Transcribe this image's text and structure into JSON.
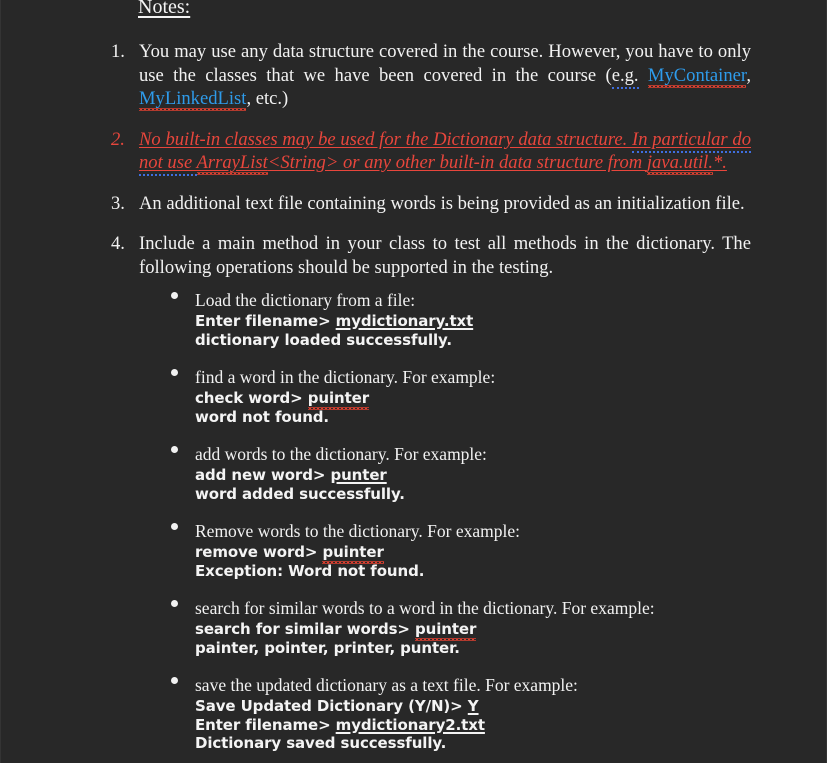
{
  "document": {
    "heading": "Notes:",
    "numbered_items": [
      {
        "marker": "1.",
        "lines": [
          {
            "segments": [
              {
                "text": "You may use any data structure covered in the course. However, you have to only use the classes that we have been covered in the course (",
                "style": "plain"
              },
              {
                "text": "e.g.",
                "style": "grammar"
              },
              {
                "text": " ",
                "style": "plain"
              },
              {
                "text": "MyContainer",
                "style": "code-spell"
              },
              {
                "text": ", ",
                "style": "plain"
              },
              {
                "text": "MyLinkedList",
                "style": "code-spell"
              },
              {
                "text": ", etc.)",
                "style": "plain"
              }
            ]
          }
        ]
      },
      {
        "marker": "2.",
        "emphasis": "red-italic-underline",
        "lines": [
          {
            "segments": [
              {
                "text": "No built-in classes may be used for the Dictionary data structure. ",
                "style": "underline"
              },
              {
                "text": "In particular do not use ",
                "style": "underline-grammar"
              },
              {
                "text": "ArrayList",
                "style": "underline-spell"
              },
              {
                "text": "<String> or any other built-in data structure from ",
                "style": "underline"
              },
              {
                "text": "java.util.",
                "style": "underline-spell"
              },
              {
                "text": "*.",
                "style": "underline"
              }
            ]
          }
        ]
      },
      {
        "marker": "3.",
        "lines": [
          {
            "segments": [
              {
                "text": "An additional text file containing words is being provided as an initialization file.",
                "style": "plain"
              }
            ]
          }
        ]
      },
      {
        "marker": "4.",
        "lines": [
          {
            "segments": [
              {
                "text": "Include a main method in your class to test all methods in the dictionary. The following operations should be supported in the testing.",
                "style": "plain"
              }
            ]
          }
        ]
      }
    ],
    "bullets": [
      {
        "description": "Load the dictionary from a file:",
        "console": [
          [
            {
              "text": "Enter filename> ",
              "style": "plain"
            },
            {
              "text": "mydictionary.txt",
              "style": "underline"
            }
          ],
          [
            {
              "text": "dictionary loaded successfully.",
              "style": "plain"
            }
          ]
        ]
      },
      {
        "description": "find a word in the dictionary. For example:",
        "console": [
          [
            {
              "text": "check word> ",
              "style": "plain"
            },
            {
              "text": "puinter",
              "style": "spell"
            }
          ],
          [
            {
              "text": "word not found.",
              "style": "plain"
            }
          ]
        ]
      },
      {
        "description": "add words to the dictionary. For example:",
        "console": [
          [
            {
              "text": "add new word> ",
              "style": "plain"
            },
            {
              "text": "punter",
              "style": "underline"
            }
          ],
          [
            {
              "text": "word added successfully.",
              "style": "plain"
            }
          ]
        ]
      },
      {
        "description": "Remove words to the dictionary. For example:",
        "console": [
          [
            {
              "text": "remove word> ",
              "style": "plain"
            },
            {
              "text": "puinter",
              "style": "spell"
            }
          ],
          [
            {
              "text": "Exception: Word not found.",
              "style": "plain"
            }
          ]
        ]
      },
      {
        "description": "search for similar words to a word in the dictionary. For example:",
        "console": [
          [
            {
              "text": "search for similar words> ",
              "style": "plain"
            },
            {
              "text": "puinter",
              "style": "spell"
            }
          ],
          [
            {
              "text": "painter, pointer, printer, punter.",
              "style": "plain"
            }
          ]
        ]
      },
      {
        "description": "save the updated dictionary as a text file. For example:",
        "console": [
          [
            {
              "text": "Save Updated Dictionary (Y/N)> ",
              "style": "plain"
            },
            {
              "text": "Y",
              "style": "underline"
            }
          ],
          [
            {
              "text": "Enter filename> ",
              "style": "plain"
            },
            {
              "text": "mydictionary2.txt",
              "style": "underline"
            }
          ],
          [
            {
              "text": "Dictionary saved successfully.",
              "style": "plain"
            }
          ]
        ]
      }
    ]
  },
  "colors": {
    "background": "#282828",
    "text": "#f2f2f2",
    "warning_red": "#e8463c",
    "code_blue": "#2e9bea",
    "spellcheck_red": "#e04030",
    "grammarcheck_blue": "#3f6fe0"
  }
}
